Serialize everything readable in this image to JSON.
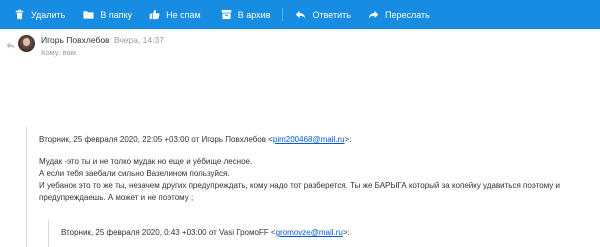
{
  "toolbar": {
    "delete": "Удалить",
    "move": "В папку",
    "not_spam": "Не спам",
    "archive": "В архив",
    "reply": "Ответить",
    "forward": "Переслать"
  },
  "message": {
    "sender": "Игорь Повхлебов",
    "date": "Вчера, 14:37",
    "recipient": "Кому: вам"
  },
  "quote1": {
    "header_prefix": "Вторник, 25 февраля 2020, 22:05 +03:00 от Игорь Повхлебов <",
    "email": "pim200468@mail.ru",
    "header_suffix": ">:",
    "lines": [
      "Мудак -это ты и не толко мудак но еще и уёбище лесное.",
      "А если тебя заебали сильно Вазелином пользуйся.",
      "И уебанок это то же ты, незачем других предупреждать, кому надо тот разберется. Ты же БАРЫГА который за копейку удавиться поэтому и",
      "предупреждаешь. А может и не поэтому ;"
    ]
  },
  "quote2": {
    "header_prefix": "Вторник, 25 февраля 2020, 0:43 +03:00 от Vasi ГромоFF <",
    "email": "gromovze@mail.ru",
    "header_suffix": ">:"
  },
  "colors": {
    "toolbar": "#168de2",
    "link": "#005bd1"
  }
}
